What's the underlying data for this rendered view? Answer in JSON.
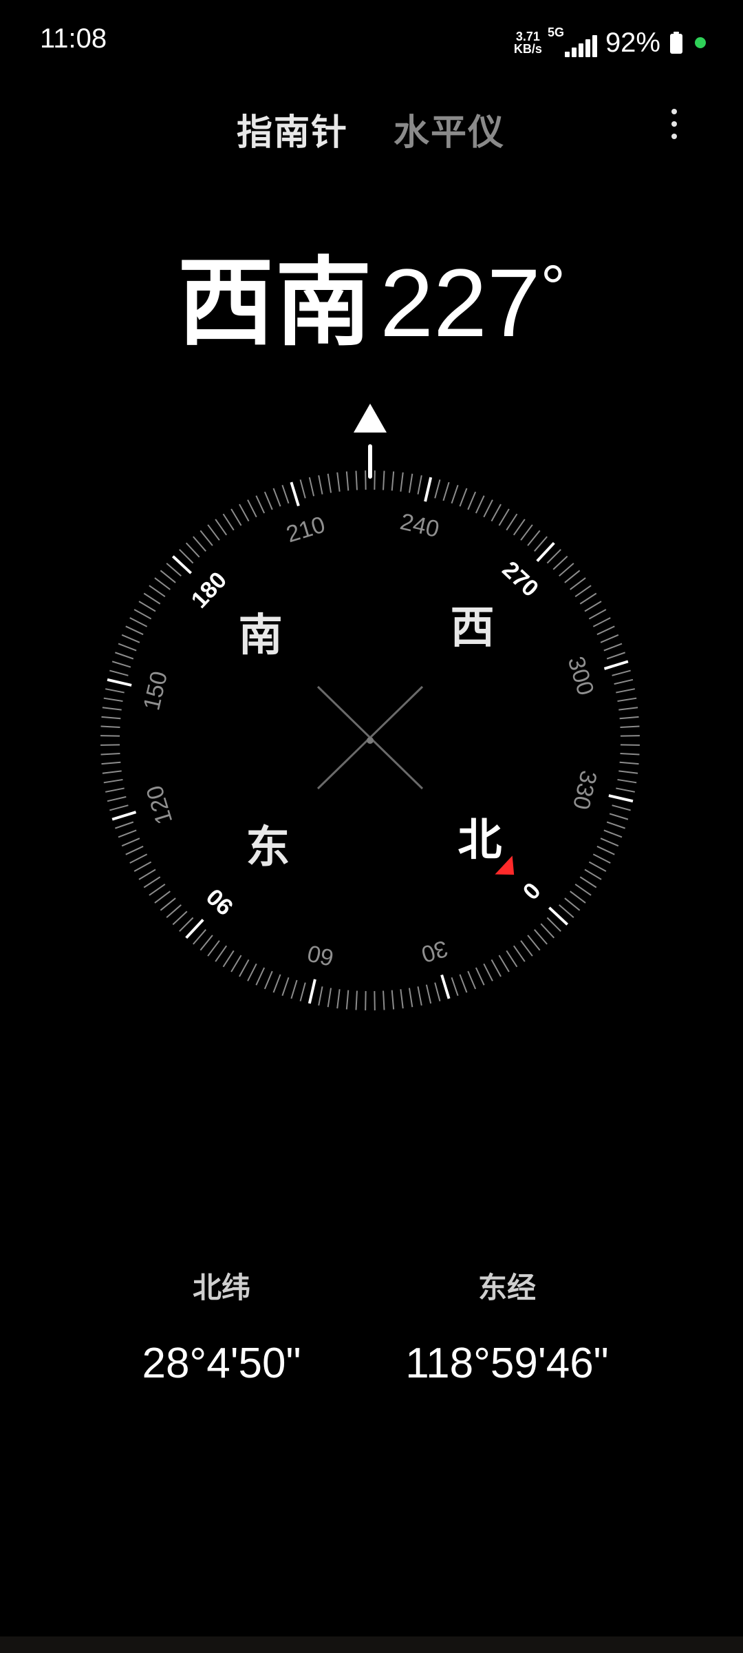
{
  "status_bar": {
    "time": "11:08",
    "net_speed_value": "3.71",
    "net_speed_unit": "KB/s",
    "network_type": "5G",
    "battery_percent": "92%",
    "privacy_dot_color": "#2fd158",
    "signal_icon": "cellular-signal-icon",
    "battery_icon": "battery-icon"
  },
  "tabs": [
    {
      "label": "指南针",
      "active": true
    },
    {
      "label": "水平仪",
      "active": false
    }
  ],
  "more_icon": "more-vertical-icon",
  "heading": {
    "direction": "西南",
    "degrees": "227",
    "degree_sign": "°"
  },
  "compass": {
    "heading_deg": 227,
    "degree_labels": [
      "0",
      "30",
      "60",
      "90",
      "120",
      "150",
      "180",
      "210",
      "240",
      "270",
      "300",
      "330"
    ],
    "cardinals": {
      "north": "北",
      "east": "东",
      "south": "南",
      "west": "西"
    },
    "north_marker_color": "#ff2a2a",
    "pointer_icon": "triangle-up-icon"
  },
  "coordinates": {
    "latitude_label": "北纬",
    "latitude_value": "28°4'50\"",
    "longitude_label": "东经",
    "longitude_value": "118°59'46\""
  }
}
